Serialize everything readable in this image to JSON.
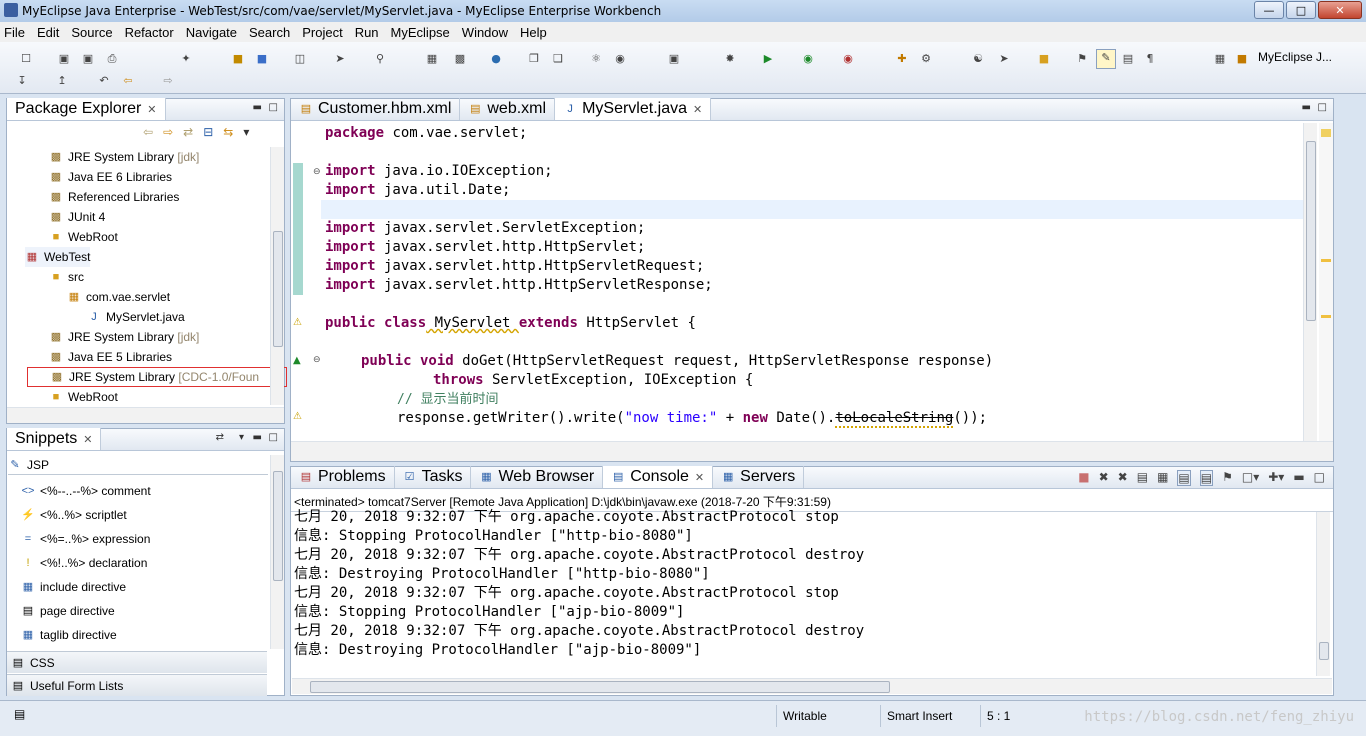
{
  "window": {
    "title": "MyEclipse Java Enterprise - WebTest/src/com/vae/servlet/MyServlet.java - MyEclipse Enterprise Workbench"
  },
  "menu": [
    "File",
    "Edit",
    "Source",
    "Refactor",
    "Navigate",
    "Search",
    "Project",
    "Run",
    "MyEclipse",
    "Window",
    "Help"
  ],
  "perspective": "MyEclipse J...",
  "package_explorer": {
    "title": "Package Explorer",
    "rows": [
      {
        "label": "JRE System Library",
        "suffix": "[jdk]"
      },
      {
        "label": "Java EE 6 Libraries",
        "suffix": ""
      },
      {
        "label": "Referenced Libraries",
        "suffix": ""
      },
      {
        "label": "JUnit 4",
        "suffix": ""
      },
      {
        "label": "WebRoot",
        "suffix": ""
      },
      {
        "label": "WebTest",
        "suffix": ""
      },
      {
        "label": "src",
        "suffix": ""
      },
      {
        "label": "com.vae.servlet",
        "suffix": ""
      },
      {
        "label": "MyServlet.java",
        "suffix": ""
      },
      {
        "label": "JRE System Library",
        "suffix": "[jdk]"
      },
      {
        "label": "Java EE 5 Libraries",
        "suffix": ""
      },
      {
        "label": "JRE System Library",
        "suffix": "[CDC-1.0/Foun"
      },
      {
        "label": "WebRoot",
        "suffix": ""
      }
    ]
  },
  "snippets": {
    "title": "Snippets",
    "group": "JSP",
    "items": [
      "<%--..--%> comment",
      "<%..%> scriptlet",
      "<%=..%> expression",
      "<%!..%> declaration",
      "include directive",
      "page directive",
      "taglib directive"
    ],
    "drawers": [
      "CSS",
      "Useful Form Lists"
    ]
  },
  "editor": {
    "tabs": [
      "Customer.hbm.xml",
      "web.xml",
      "MyServlet.java"
    ],
    "code": {
      "l1_kw": "package",
      "l1": " com.vae.servlet;",
      "l3_kw": "import",
      "l3": " java.io.IOException;",
      "l4_kw": "import",
      "l4": " java.util.Date;",
      "l6_kw": "import",
      "l6": " javax.servlet.ServletException;",
      "l7_kw": "import",
      "l7": " javax.servlet.http.HttpServlet;",
      "l8_kw": "import",
      "l8": " javax.servlet.http.HttpServletRequest;",
      "l9_kw": "import",
      "l9": " javax.servlet.http.HttpServletResponse;",
      "l11_kw": "public class",
      "l11_a": " MyServlet ",
      "l11_kw2": "extends",
      "l11_b": " HttpServlet {",
      "l13_kw": "public void",
      "l13": " doGet(HttpServletRequest request, HttpServletResponse response)",
      "l14_kw": "throws",
      "l14": " ServletException, IOException {",
      "l15": "// 显示当前时间",
      "l16_a": "response.getWriter().write(",
      "l16_str": "\"now time:\"",
      "l16_b": " + ",
      "l16_kw": "new",
      "l16_c": " Date().",
      "l16_d": "toLocaleString",
      "l16_e": "());"
    }
  },
  "console": {
    "tabs": [
      "Problems",
      "Tasks",
      "Web Browser",
      "Console",
      "Servers"
    ],
    "header": "<terminated> tomcat7Server [Remote Java Application] D:\\jdk\\bin\\javaw.exe (2018-7-20 下午9:31:59)",
    "lines": [
      "七月 20, 2018 9:32:07 下午 org.apache.coyote.AbstractProtocol stop",
      "信息: Stopping ProtocolHandler [\"http-bio-8080\"]",
      "七月 20, 2018 9:32:07 下午 org.apache.coyote.AbstractProtocol destroy",
      "信息: Destroying ProtocolHandler [\"http-bio-8080\"]",
      "七月 20, 2018 9:32:07 下午 org.apache.coyote.AbstractProtocol stop",
      "信息: Stopping ProtocolHandler [\"ajp-bio-8009\"]",
      "七月 20, 2018 9:32:07 下午 org.apache.coyote.AbstractProtocol destroy",
      "信息: Destroying ProtocolHandler [\"ajp-bio-8009\"]"
    ]
  },
  "status": {
    "writable": "Writable",
    "insert_mode": "Smart Insert",
    "position": "5 : 1",
    "watermark": "https://blog.csdn.net/feng_zhiyu"
  }
}
